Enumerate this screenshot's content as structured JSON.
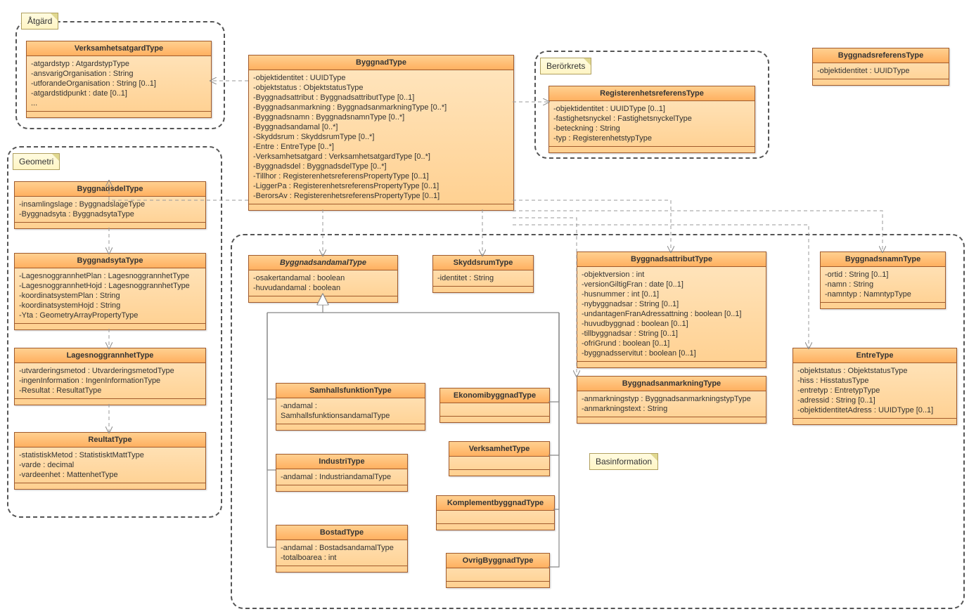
{
  "packages": {
    "atgard": {
      "label": "Åtgärd"
    },
    "berorkrets": {
      "label": "Berörkrets"
    },
    "geometri": {
      "label": "Geometri"
    },
    "basinformation": {
      "label": "Basinformation"
    }
  },
  "classes": {
    "VerksamhetsatgardType": {
      "title": "VerksamhetsatgardType",
      "attrs": "-atgardstyp : AtgardstypType\n-ansvarigOrganisation : String\n-utforandeOrganisation : String [0..1]\n-atgardstidpunkt : date [0..1]\n..."
    },
    "ByggnadType": {
      "title": "ByggnadType",
      "attrs": "-objektidentitet : UUIDType\n-objektstatus : ObjektstatusType\n-Byggnadsattribut : ByggnadsattributType [0..1]\n-Byggnadsanmarkning : ByggnadsanmarkningType [0..*]\n-Byggnadsnamn : ByggnadsnamnType [0..*]\n-Byggnadsandamal [0..*]\n-Skyddsrum : SkyddsrumType [0..*]\n-Entre : EntreType [0..*]\n-Verksamhetsatgard : VerksamhetsatgardType [0..*]\n-Byggnadsdel : ByggnadsdelType [0..*]\n-Tillhor : RegisterenhetsreferensPropertyType [0..1]\n-LiggerPa : RegisterenhetsreferensPropertyType [0..1]\n-BerorsAv : RegisterenhetsreferensPropertyType [0..1]"
    },
    "RegisterenhetsreferensType": {
      "title": "RegisterenhetsreferensType",
      "attrs": "-objektidentitet : UUIDType [0..1]\n-fastighetsnyckel : FastighetsnyckelType\n-beteckning : String\n-typ : RegisterenhetstypType"
    },
    "ByggnadsreferensType": {
      "title": "ByggnadsreferensType",
      "attrs": "-objektidentitet : UUIDType"
    },
    "ByggnadsdelType": {
      "title": "ByggnadsdelType",
      "attrs": "-insamlingslage : ByggnadslageType\n-Byggnadsyta : ByggnadsytaType"
    },
    "ByggnadsytaType": {
      "title": "ByggnadsytaType",
      "attrs": "-LagesnoggrannhetPlan : LagesnoggrannhetType\n-LagesnoggrannhetHojd : LagesnoggrannhetType\n-koordinatsystemPlan : String\n-koordinatsystemHojd : String\n-Yta : GeometryArrayPropertyType"
    },
    "LagesnoggrannhetType": {
      "title": "LagesnoggrannhetType",
      "attrs": "-utvarderingsmetod : UtvarderingsmetodType\n-ingenInformation : IngenInformationType\n-Resultat : ResultatType"
    },
    "ReultatType": {
      "title": "ReultatType",
      "attrs": "-statistiskMetod : StatistisktMattType\n-varde : decimal\n-vardeenhet : MattenhetType"
    },
    "ByggnadsandamalType": {
      "title": "ByggnadsandamalType",
      "attrs": "-osakertandamal : boolean\n-huvudandamal : boolean"
    },
    "SkyddsrumType": {
      "title": "SkyddsrumType",
      "attrs": "-identitet : String"
    },
    "ByggnadsattributType": {
      "title": "ByggnadsattributType",
      "attrs": "-objektversion : int\n-versionGiltigFran : date [0..1]\n-husnummer : int [0..1]\n-nybyggnadsar : String [0..1]\n-undantagenFranAdressattning : boolean [0..1]\n-huvudbyggnad : boolean [0..1]\n-tillbyggnadsar : String [0..1]\n-ofriGrund : boolean [0..1]\n-byggnadsservitut : boolean [0..1]"
    },
    "ByggnadsnamnType": {
      "title": "ByggnadsnamnType",
      "attrs": "-ortid : String [0..1]\n-namn : String\n-namntyp : NamntypType"
    },
    "EntreType": {
      "title": "EntreType",
      "attrs": "-objektstatus : ObjektstatusType\n-hiss : HisstatusType\n-entretyp : EntretypType\n-adressid : String [0..1]\n-objektidentitetAdress : UUIDType [0..1]"
    },
    "ByggnadsanmarkningType": {
      "title": "ByggnadsanmarkningType",
      "attrs": "-anmarkningstyp : ByggnadsanmarkningstypType\n-anmarkningstext : String"
    },
    "SamhallsfunktionType": {
      "title": "SamhallsfunktionType",
      "attrs": "-andamal : SamhallsfunktionsandamalType"
    },
    "EkonomibyggnadType": {
      "title": "EkonomibyggnadType",
      "attrs": ""
    },
    "IndustriType": {
      "title": "IndustriType",
      "attrs": "-andamal : IndustriandamalType"
    },
    "VerksamhetType": {
      "title": "VerksamhetType",
      "attrs": ""
    },
    "KomplementbyggnadType": {
      "title": "KomplementbyggnadType",
      "attrs": ""
    },
    "BostadType": {
      "title": "BostadType",
      "attrs": "-andamal : BostadsandamalType\n-totalboarea : int"
    },
    "OvrigByggnadType": {
      "title": "OvrigByggnadType",
      "attrs": ""
    }
  }
}
